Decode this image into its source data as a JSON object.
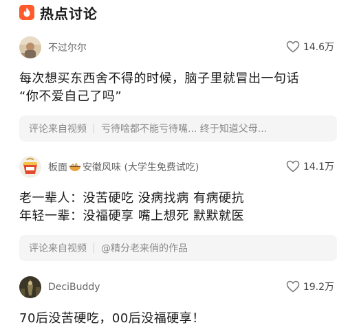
{
  "header": {
    "title": "热点讨论",
    "icon": "fire-icon",
    "accent": "#ff5a2c"
  },
  "comments": [
    {
      "username": "不过尔尔",
      "likes": "14.6万",
      "lines": [
        "每次想买东西舍不得的时候，脑子里就冒出一句话",
        "“你不爱自己了吗”"
      ],
      "source_label": "评论来自视频",
      "source_text": "亏待啥都不能亏待嘴... 终于知道父母..."
    },
    {
      "username_prefix": "板面",
      "username_emoji": "noodle-bowl-icon",
      "username_suffix": "安徽风味 (大学生免费试吃)",
      "likes": "14.1万",
      "lines": [
        "老一辈人：没苦硬吃 没病找病 有病硬抗",
        "年轻一辈：没福硬享 嘴上想死 默默就医"
      ],
      "source_label": "评论来自视频",
      "source_text": "@精分老来俏的作品"
    },
    {
      "username": "DeciBuddy",
      "likes": "19.2万",
      "lines": [
        "70后没苦硬吃，00后没福硬享！"
      ]
    }
  ]
}
